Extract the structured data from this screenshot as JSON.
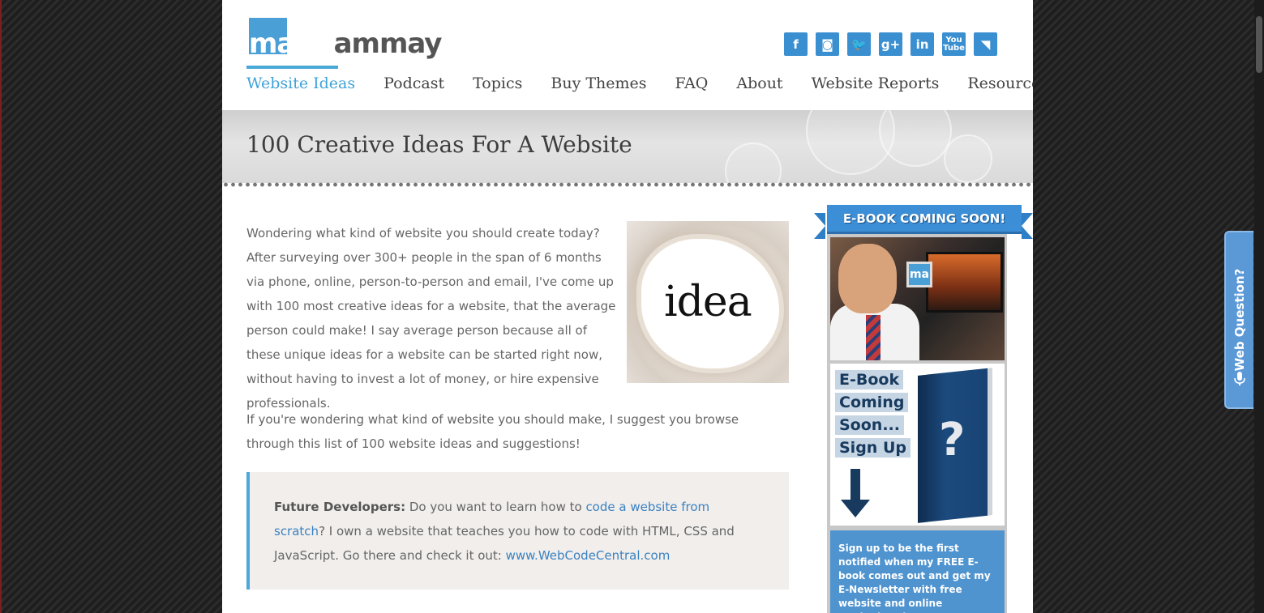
{
  "logo": {
    "mark": "mark",
    "rest": " ammay"
  },
  "social": [
    {
      "icon": "facebook-icon",
      "glyph": "f"
    },
    {
      "icon": "instagram-icon",
      "glyph": "◙"
    },
    {
      "icon": "twitter-icon",
      "glyph": "🐦"
    },
    {
      "icon": "google-plus-icon",
      "glyph": "g+"
    },
    {
      "icon": "linkedin-icon",
      "glyph": "in"
    },
    {
      "icon": "youtube-icon",
      "glyph": "You Tube"
    },
    {
      "icon": "rss-icon",
      "glyph": "◥"
    }
  ],
  "nav": [
    "Website Ideas",
    "Podcast",
    "Topics",
    "Buy Themes",
    "FAQ",
    "About",
    "Website Reports",
    "Resources"
  ],
  "page_title": "100 Creative Ideas For A Website",
  "intro": "Wondering what kind of website you should create today? After surveying over 300+ people in the span of 6 months via phone, online, person-to-person and email, I've come up with 100 most creative ideas for a website, that the average person could make! I say average person because all of these unique ideas for a website can be started right now, without having to invest a lot of money, or hire expensive professionals.",
  "idea_image_text": "idea",
  "suggestion": "If you're wondering what kind of website you should make, I suggest you browse through this list of 100 website ideas and suggestions!",
  "callout": {
    "lead": "Future Developers:",
    "text1": " Do you want to learn how to ",
    "link1": "code a website from scratch",
    "text2": "? I own a website that teaches you how to code with HTML, CSS and JavaScript. Go there and check it out: ",
    "link2": "www.WebCodeCentral.com"
  },
  "sidebar": {
    "ribbon": "E-BOOK COMING SOON!",
    "photo_badge": "ma",
    "ebook_lines": [
      "E-Book",
      "Coming",
      "Soon...",
      "Sign Up"
    ],
    "book_mark": "?",
    "signup": "Sign up to be the first notified when my FREE E-book comes out and get my E-Newsletter with free website and online marketing tips!"
  },
  "web_question": "Web Question?",
  "colors": {
    "accent": "#3fa3d8",
    "link": "#3b82c0",
    "sidebar_blue": "#4f93cf"
  }
}
